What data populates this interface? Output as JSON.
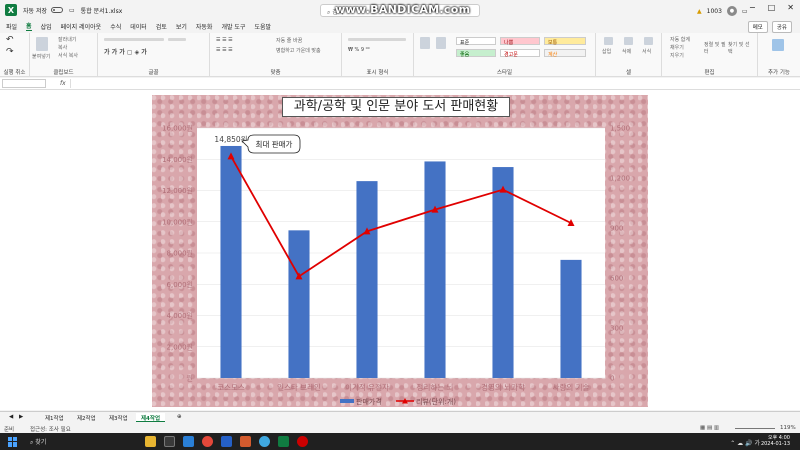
{
  "titlebar": {
    "autosave": "자동 저장",
    "filename": "통합 문서1.xlsx",
    "search_placeholder": "검색",
    "watermark": "www.BANDICAM.com",
    "count": "1003"
  },
  "menu": [
    "파일",
    "홈",
    "삽입",
    "페이지 레이아웃",
    "수식",
    "데이터",
    "검토",
    "보기",
    "자동화",
    "개발 도구",
    "도움말"
  ],
  "menu_active": "홈",
  "menu_right": {
    "memo": "메모",
    "share": "공유"
  },
  "ribbon": {
    "groups": [
      "실행 취소",
      "클립보드",
      "글꼴",
      "맞춤",
      "표시 형식",
      "스타일",
      "셀",
      "편집",
      "추가 기능"
    ],
    "clipboard": [
      "붙여넣기",
      "잘라내기",
      "복사",
      "서식 복사"
    ],
    "alignment": [
      "자동 줄 바꿈",
      "병합하고 가운데 맞춤"
    ],
    "styles": [
      "표준",
      "나쁨",
      "보통",
      "좋음",
      "경고문",
      "계산"
    ],
    "cells": [
      "삽입",
      "삭제",
      "서식"
    ],
    "editing": [
      "자동 합계",
      "채우기",
      "지우기",
      "정렬 및 필터",
      "찾기 및 선택"
    ]
  },
  "formula": {
    "fx": "fx"
  },
  "chart_data": {
    "type": "bar",
    "title": "과학/공학 및 인문 분야 도서 판매현황",
    "categories": [
      "코스모스",
      "인스타 브레인",
      "이기적 유전자",
      "정리하는 뇌",
      "경영의 뇌과학",
      "사랑의 기술"
    ],
    "series": [
      {
        "name": "판매가격",
        "type": "bar",
        "axis": "left",
        "color": "#4472c4",
        "values": [
          14850,
          9450,
          12600,
          13860,
          13500,
          7560
        ]
      },
      {
        "name": "리뷰(단위:개)",
        "type": "line",
        "axis": "right",
        "color": "#e00000",
        "values": [
          1330,
          610,
          880,
          1010,
          1130,
          930
        ]
      }
    ],
    "y_left_ticks": [
      "원",
      "2,000원",
      "4,000원",
      "6,000원",
      "8,000원",
      "10,000원",
      "12,000원",
      "14,000원",
      "16,000원"
    ],
    "y_left_range": [
      0,
      16000
    ],
    "y_right_ticks": [
      "0",
      "300",
      "600",
      "900",
      "1,200",
      "1,500"
    ],
    "y_right_range": [
      0,
      1500
    ],
    "data_label": "14,850원",
    "callout": "최대 판매가",
    "legend_position": "bottom",
    "grid": true
  },
  "sheets": [
    "제1작업",
    "제2작업",
    "제3작업",
    "제4작업"
  ],
  "active_sheet": "제4작업",
  "status": {
    "ready": "준비",
    "accessibility": "접근성: 조사 필요",
    "zoom": "119%"
  },
  "taskbar": {
    "search": "찾기",
    "time": "오후 4:00",
    "date": "2024-01-13"
  }
}
